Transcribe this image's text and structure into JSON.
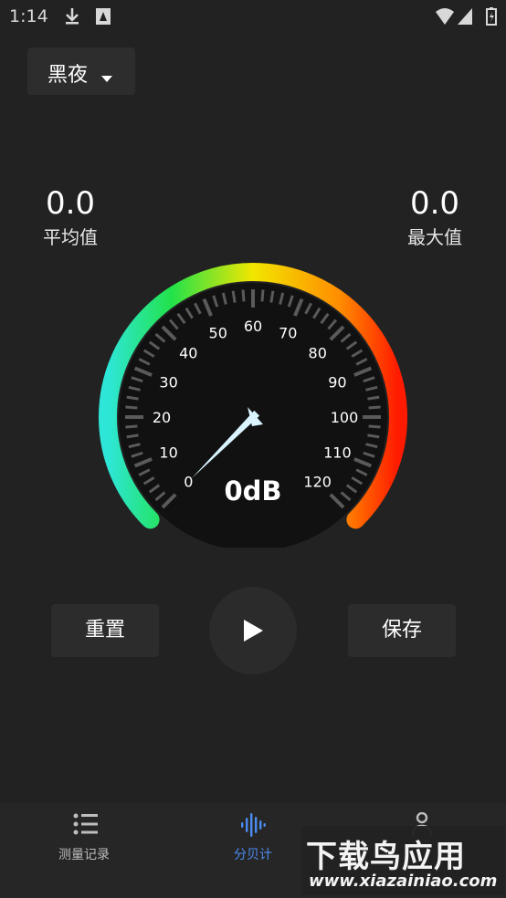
{
  "status_bar": {
    "time": "1:14",
    "icons": [
      "download-icon",
      "notification-app-icon",
      "wifi-icon",
      "signal-icon",
      "battery-icon"
    ]
  },
  "mode_selector": {
    "label": "黑夜",
    "icon": "caret-down-icon"
  },
  "stats": {
    "average": {
      "value": "0.0",
      "label": "平均值"
    },
    "max": {
      "value": "0.0",
      "label": "最大值"
    }
  },
  "gauge": {
    "reading": "0dB",
    "tick_labels": [
      "0",
      "10",
      "20",
      "30",
      "40",
      "50",
      "60",
      "70",
      "80",
      "90",
      "100",
      "110",
      "120"
    ],
    "colors": {
      "start": "#2ee6d8",
      "green": "#22e24a",
      "yellow": "#f2e600",
      "orange": "#ff8c00",
      "end": "#ff1a00",
      "needle": "#d9f4ff",
      "track": "#111111",
      "tick": "#5a5a5a"
    }
  },
  "actions": {
    "reset_label": "重置",
    "play_icon": "play-icon",
    "save_label": "保存"
  },
  "bottom_nav": {
    "items": [
      {
        "label": "测量记录",
        "icon": "list-icon",
        "active": false
      },
      {
        "label": "分贝计",
        "icon": "sound-wave-icon",
        "active": true
      },
      {
        "label": "",
        "icon": "person-icon",
        "active": false
      }
    ],
    "active_color": "#4c8cf0",
    "inactive_color": "#bdbdbd"
  },
  "watermark": {
    "title": "下载鸟应用",
    "url": "www.xiazainiao.com"
  }
}
